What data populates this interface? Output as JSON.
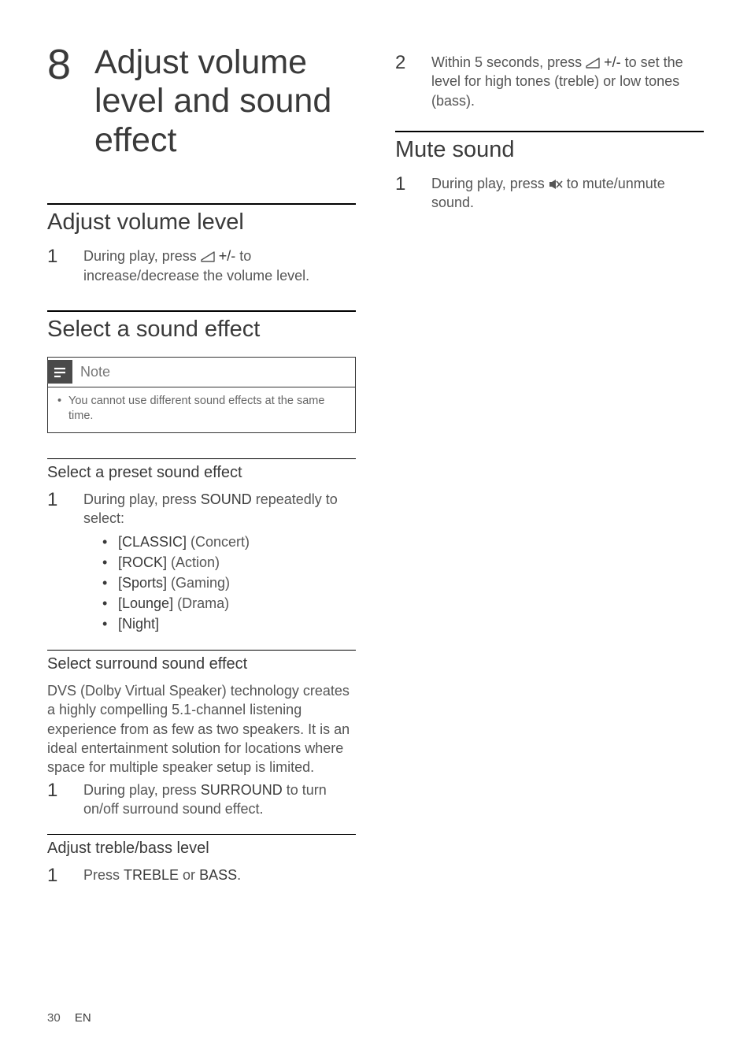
{
  "chapter": {
    "number": "8",
    "title": "Adjust volume level and sound effect"
  },
  "left": {
    "s1": {
      "title": "Adjust volume level",
      "step1_num": "1",
      "step1_a": "During play, press ",
      "step1_b": " +/-",
      "step1_c": " to increase/decrease the volume level."
    },
    "s2": {
      "title": "Select a sound effect",
      "note_label": "Note",
      "note_item": "You cannot use different sound effects at the same time."
    },
    "s3": {
      "title": "Select a preset sound effect",
      "step1_num": "1",
      "step1_a": "During play, press ",
      "step1_b": "SOUND",
      "step1_c": " repeatedly to select:",
      "opt1_b": "[CLASSIC]",
      "opt1_t": " (Concert)",
      "opt2_b": "[ROCK]",
      "opt2_t": " (Action)",
      "opt3_b": "[Sports]",
      "opt3_t": " (Gaming)",
      "opt4_b": "[Lounge]",
      "opt4_t": " (Drama)",
      "opt5_b": "[Night]"
    },
    "s4": {
      "title": "Select surround sound effect",
      "para": "DVS (Dolby Virtual Speaker) technology creates a highly compelling 5.1-channel listening experience from as few as two speakers. It is an ideal entertainment solution for locations where space for multiple speaker setup is limited.",
      "step1_num": "1",
      "step1_a": "During play, press ",
      "step1_b": "SURROUND",
      "step1_c": " to turn on/off surround sound effect."
    },
    "s5": {
      "title": "Adjust treble/bass level",
      "step1_num": "1",
      "step1_a": "Press ",
      "step1_b": "TREBLE",
      "step1_c": " or ",
      "step1_d": "BASS",
      "step1_e": "."
    }
  },
  "right": {
    "top": {
      "step2_num": "2",
      "step2_a": "Within 5 seconds, press ",
      "step2_b": " +/-",
      "step2_c": " to set the level for high tones (treble) or low tones (bass)."
    },
    "s1": {
      "title": "Mute sound",
      "step1_num": "1",
      "step1_a": "During play, press ",
      "step1_b": " to mute/unmute sound."
    }
  },
  "footer": {
    "page": "30",
    "lang": "EN"
  }
}
